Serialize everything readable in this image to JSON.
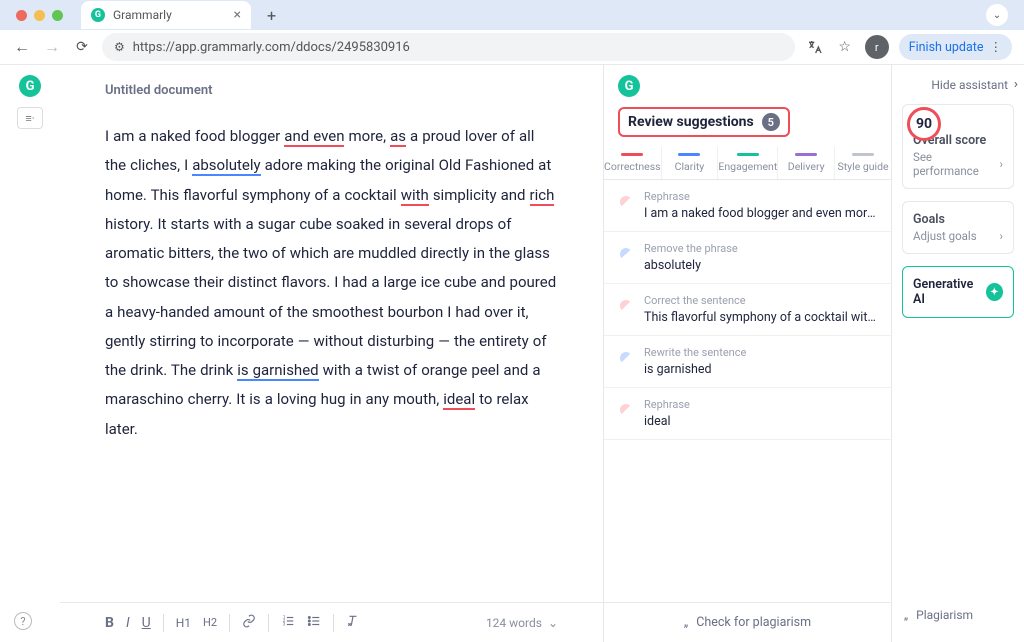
{
  "browser": {
    "tab_title": "Grammarly",
    "url": "https://app.grammarly.com/ddocs/2495830916",
    "finish_update": "Finish update",
    "avatar_letter": "r"
  },
  "doc": {
    "title": "Untitled document",
    "body_parts": {
      "p0": "I am a naked food blogger ",
      "p1": "and even",
      "p2": " more, ",
      "p3": "as",
      "p4": " a proud lover of all the cliches, I ",
      "p5": "absolutely",
      "p6": " adore making the original Old Fashioned at home. This flavorful symphony of a cocktail ",
      "p7": "with",
      "p8": " simplicity and ",
      "p9": "rich",
      "p10": " history. It starts with a sugar cube soaked in several drops of aromatic bitters, the two of which are muddled directly in the glass to showcase their distinct flavors. I had a large ice cube and poured a heavy-handed amount of the smoothest bourbon I had over it, gently stirring to incorporate — without disturbing — the entirety of the drink. The drink ",
      "p11": "is garnished",
      "p12": " with a twist of orange peel and a maraschino cherry. It is a loving hug in any mouth, ",
      "p13": "ideal",
      "p14": " to relax later."
    },
    "word_count": "124 words"
  },
  "suggestions": {
    "header": "Review suggestions",
    "count": "5",
    "tabs": [
      "Correctness",
      "Clarity",
      "Engagement",
      "Delivery",
      "Style guide"
    ],
    "items": [
      {
        "type": "Rephrase",
        "text": "I am a naked food blogger and even more, as a…",
        "color": "red",
        "arrow": true
      },
      {
        "type": "Remove the phrase",
        "text": "absolutely",
        "color": "blue",
        "arrow": true
      },
      {
        "type": "Correct the sentence",
        "text": "This flavorful symphony of a cocktail with simplicit…",
        "color": "red",
        "arrow": false
      },
      {
        "type": "Rewrite the sentence",
        "text": "is garnished",
        "color": "blue",
        "arrow": false
      },
      {
        "type": "Rephrase",
        "text": "ideal",
        "color": "red",
        "arrow": false
      }
    ],
    "footer": "Check for plagiarism"
  },
  "side": {
    "hide": "Hide assistant",
    "score": "90",
    "overall": "Overall score",
    "see_perf": "See performance",
    "goals": "Goals",
    "adjust": "Adjust goals",
    "gen_ai": "Generative AI",
    "plagiarism": "Plagiarism"
  },
  "format": {
    "h1": "H1",
    "h2": "H2"
  }
}
